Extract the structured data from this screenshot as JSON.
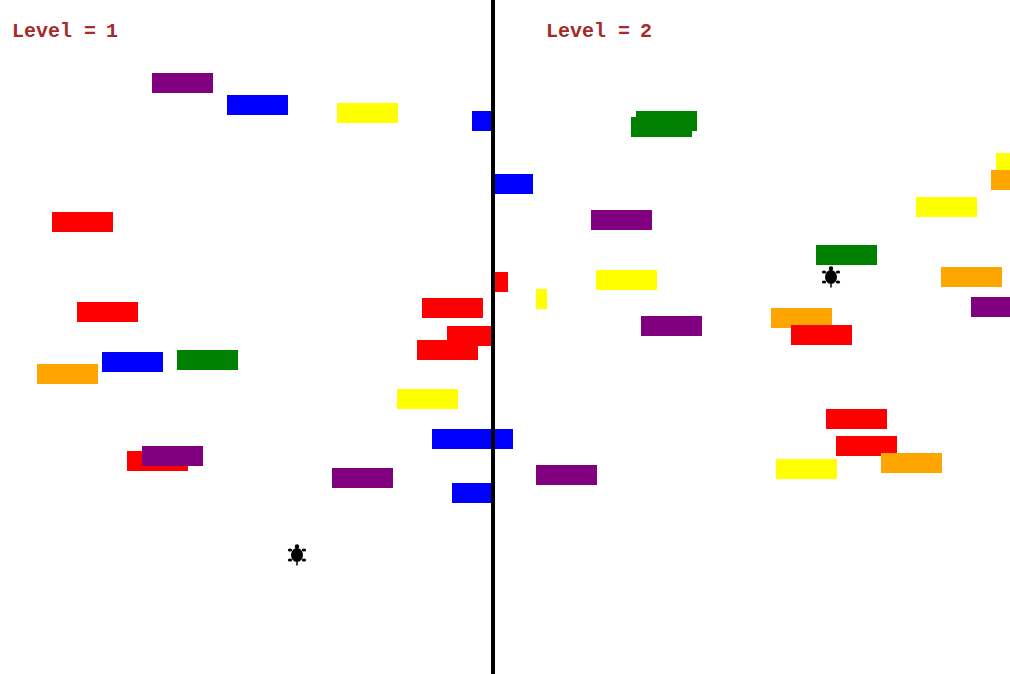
{
  "panels": [
    {
      "label": "Level =",
      "level": "1",
      "bricks": [
        {
          "color": "#800080"
        },
        {
          "color": "#0000ff"
        },
        {
          "color": "#ffff00"
        },
        {
          "color": "#0000ff"
        },
        {
          "color": "#ff0000"
        },
        {
          "color": "#ff0000"
        },
        {
          "color": "#ff0000"
        },
        {
          "color": "#ff0000"
        },
        {
          "color": "#ff0000"
        },
        {
          "color": "#ffa500"
        },
        {
          "color": "#0000ff"
        },
        {
          "color": "#008000"
        },
        {
          "color": "#ffff00"
        },
        {
          "color": "#0000ff"
        },
        {
          "color": "#ff0000"
        },
        {
          "color": "#800080"
        },
        {
          "color": "#800080"
        },
        {
          "color": "#0000ff"
        }
      ]
    },
    {
      "label": "Level =",
      "level": "2",
      "bricks": [
        {
          "color": "#008000"
        },
        {
          "color": "#008000"
        },
        {
          "color": "#0000ff"
        },
        {
          "color": "#ffff00"
        },
        {
          "color": "#ffa500"
        },
        {
          "color": "#ffff00"
        },
        {
          "color": "#800080"
        },
        {
          "color": "#008000"
        },
        {
          "color": "#ff0000"
        },
        {
          "color": "#ffff00"
        },
        {
          "color": "#ffff00"
        },
        {
          "color": "#ffa500"
        },
        {
          "color": "#800080"
        },
        {
          "color": "#800080"
        },
        {
          "color": "#ffa500"
        },
        {
          "color": "#ff0000"
        },
        {
          "color": "#ff0000"
        },
        {
          "color": "#ff0000"
        },
        {
          "color": "#ffff00"
        },
        {
          "color": "#ffa500"
        },
        {
          "color": "#800080"
        },
        {
          "color": "#0000ff"
        }
      ]
    }
  ]
}
